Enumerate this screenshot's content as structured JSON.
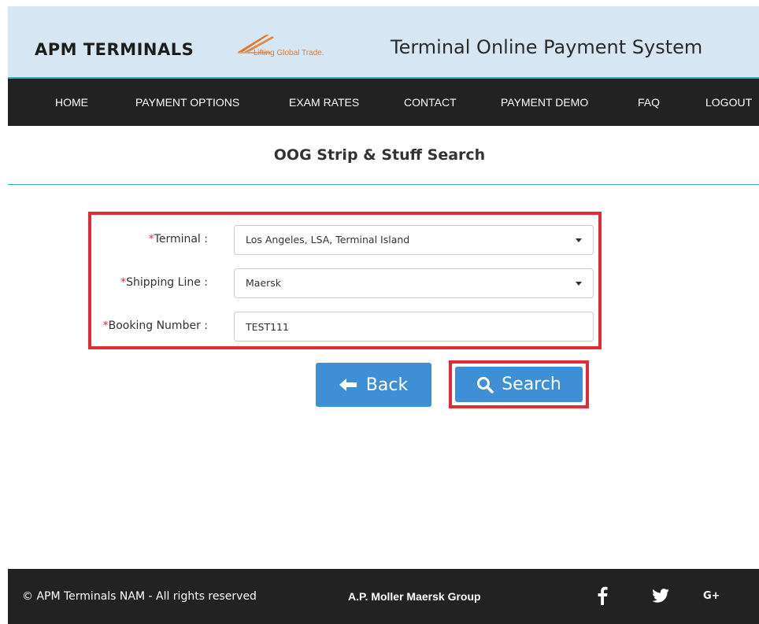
{
  "header": {
    "logo_text": "APM TERMINALS",
    "logo_tagline": "Lifting Global Trade.",
    "app_title": "Terminal Online Payment System"
  },
  "nav": {
    "items": [
      "HOME",
      "PAYMENT OPTIONS",
      "EXAM RATES",
      "CONTACT",
      "PAYMENT DEMO",
      "FAQ",
      "LOGOUT"
    ]
  },
  "page": {
    "title": "OOG Strip & Stuff Search"
  },
  "form": {
    "required_mark": "*",
    "terminal": {
      "label": "Terminal :",
      "value": "Los Angeles, LSA, Terminal Island"
    },
    "shipping_line": {
      "label": "Shipping Line :",
      "value": "Maersk"
    },
    "booking_number": {
      "label": "Booking Number :",
      "value": "TEST111"
    }
  },
  "buttons": {
    "back": "Back",
    "search": "Search"
  },
  "footer": {
    "copyright": "© APM Terminals NAM - All rights reserved",
    "group": "A.P. Moller Maersk Group",
    "social_icons": [
      "facebook-icon",
      "twitter-icon",
      "google-plus-icon"
    ],
    "google_plus_label": "G+"
  },
  "colors": {
    "nav_bg": "#222222",
    "header_bg": "#d6e6f2",
    "accent_line": "#3fa7c4",
    "button_blue": "#3e8fd6",
    "highlight_red": "#e32b38",
    "logo_orange": "#e6782a"
  }
}
